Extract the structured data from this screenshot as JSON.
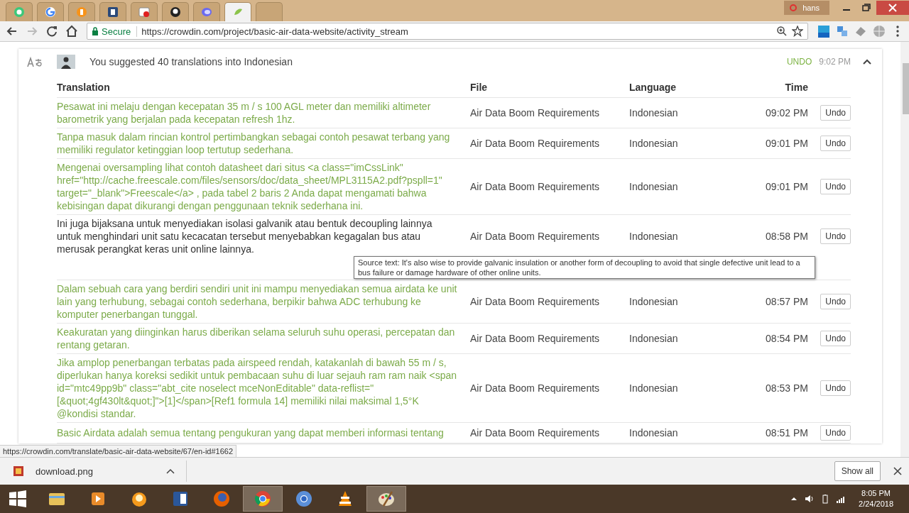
{
  "browser": {
    "tabs": [
      {
        "selected": false
      },
      {
        "selected": false
      },
      {
        "selected": false
      },
      {
        "selected": false
      },
      {
        "selected": false
      },
      {
        "selected": false
      },
      {
        "selected": false
      },
      {
        "selected": true
      },
      {
        "selected": false
      }
    ],
    "profile": "hans",
    "secure_label": "Secure",
    "url": "https://crowdin.com/project/basic-air-data-website/activity_stream"
  },
  "activity": {
    "message": "You suggested 40 translations into Indonesian",
    "undo": "UNDO",
    "time": "9:02 PM",
    "expanded": true,
    "columns": [
      "Translation",
      "File",
      "Language",
      "Time"
    ],
    "rows": [
      {
        "translation": "Pesawat ini melaju dengan kecepatan 35 m / s 100 AGL meter dan memiliki altimeter barometrik yang berjalan pada kecepatan refresh 1hz.",
        "file": "Air Data Boom Requirements",
        "language": "Indonesian",
        "time": "09:02 PM",
        "action": "Undo",
        "hovered": false
      },
      {
        "translation": "Tanpa masuk dalam rincian kontrol pertimbangkan sebagai contoh pesawat terbang yang memiliki regulator ketinggian loop tertutup sederhana.",
        "file": "Air Data Boom Requirements",
        "language": "Indonesian",
        "time": "09:01 PM",
        "action": "Undo",
        "hovered": false
      },
      {
        "translation": "Mengenai oversampling lihat contoh datasheet dari situs <a class=\"imCssLink\" href=\"http://cache.freescale.com/files/sensors/doc/data_sheet/MPL3115A2.pdf?pspll=1\" target=\"_blank\">Freescale</a> , pada tabel 2 baris 2 Anda dapat mengamati bahwa kebisingan dapat dikurangi dengan penggunaan teknik sederhana ini.",
        "file": "Air Data Boom Requirements",
        "language": "Indonesian",
        "time": "09:01 PM",
        "action": "Undo",
        "hovered": false
      },
      {
        "translation": "Ini juga bijaksana untuk menyediakan isolasi galvanik atau bentuk decoupling lainnya untuk menghindari unit satu kecacatan tersebut menyebabkan kegagalan bus atau merusak perangkat keras unit online lainnya.",
        "file": "Air Data Boom Requirements",
        "language": "Indonesian",
        "time": "08:58 PM",
        "action": "Undo",
        "hovered": true,
        "tooltip": "Source text: It's also wise to provide galvanic insulation or another form of decoupling to avoid that single defective unit lead to a bus failure or damage hardware of other online units."
      },
      {
        "translation": "Dalam sebuah cara yang berdiri sendiri unit ini mampu menyediakan semua airdata ke unit lain yang terhubung, sebagai contoh sederhana, berpikir bahwa ADC terhubung ke komputer penerbangan tunggal.",
        "file": "Air Data Boom Requirements",
        "language": "Indonesian",
        "time": "08:57 PM",
        "action": "Undo",
        "hovered": false
      },
      {
        "translation": "Keakuratan yang diinginkan harus diberikan selama seluruh suhu operasi, percepatan dan rentang getaran.",
        "file": "Air Data Boom Requirements",
        "language": "Indonesian",
        "time": "08:54 PM",
        "action": "Undo",
        "hovered": false
      },
      {
        "translation": "Jika amplop penerbangan terbatas pada airspeed rendah, katakanlah di bawah 55 m / s, diperlukan hanya koreksi sedikit untuk pembacaan suhu di luar sejauh ram ram naik <span id=\"mtc49pp9b\" class=\"abt_cite noselect mceNonEditable\" data-reflist=\"[&quot;4gf430lt&quot;]\">[1]</span>[Ref1 formula 14] memiliki nilai maksimal 1,5°K @kondisi standar.",
        "file": "Air Data Boom Requirements",
        "language": "Indonesian",
        "time": "08:53 PM",
        "action": "Undo",
        "hovered": false
      },
      {
        "translation": "Basic Airdata adalah semua tentang pengukuran yang dapat memberi informasi tentang",
        "file": "Air Data Boom Requirements",
        "language": "Indonesian",
        "time": "08:51 PM",
        "action": "Undo",
        "hovered": false
      }
    ]
  },
  "status_url": "https://crowdin.com/translate/basic-air-data-website/67/en-id#1662",
  "download": {
    "filename": "download.png",
    "show_all": "Show all"
  },
  "taskbar": [
    {
      "selected": false
    },
    {
      "selected": false
    },
    {
      "selected": false
    },
    {
      "selected": false
    },
    {
      "selected": false
    },
    {
      "selected": true
    },
    {
      "selected": false
    },
    {
      "selected": false
    },
    {
      "selected": true
    }
  ],
  "clock": {
    "time": "8:05 PM",
    "date": "2/24/2018"
  }
}
